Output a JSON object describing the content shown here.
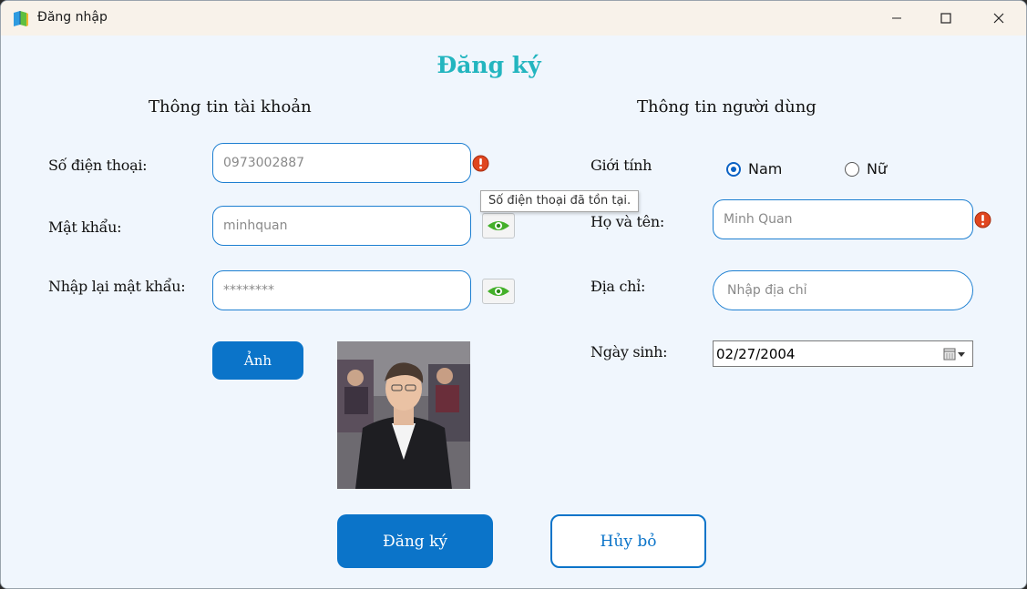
{
  "window": {
    "title": "Đăng nhập",
    "controls": {
      "minimize": "minimize-icon",
      "maximize": "maximize-icon",
      "close": "close-icon"
    }
  },
  "form": {
    "title": "Đăng ký",
    "account_section": {
      "title": "Thông tin tài khoản",
      "phone": {
        "label": "Số điện thoại:",
        "value": "0973002887",
        "error_tooltip": "Số điện thoại đã tồn tại."
      },
      "password": {
        "label": "Mật khẩu:",
        "value": "minhquan"
      },
      "confirm_password": {
        "label": "Nhập lại mật khẩu:",
        "value": "********"
      },
      "photo_button": "Ảnh"
    },
    "user_section": {
      "title": "Thông tin người dùng",
      "gender": {
        "label": "Giới tính",
        "options": [
          "Nam",
          "Nữ"
        ],
        "selected": "Nam"
      },
      "full_name": {
        "label": "Họ và tên:",
        "value": "Minh Quan"
      },
      "address": {
        "label": "Địa chỉ:",
        "placeholder": "Nhập địa chỉ"
      },
      "birthday": {
        "label": "Ngày sinh:",
        "value": "02/27/2004"
      }
    },
    "buttons": {
      "submit": "Đăng ký",
      "cancel": "Hủy bỏ"
    }
  },
  "colors": {
    "accent": "#0b74c9",
    "title": "#23b5bf",
    "error": "#e0461f",
    "background": "#f0f6fd"
  }
}
